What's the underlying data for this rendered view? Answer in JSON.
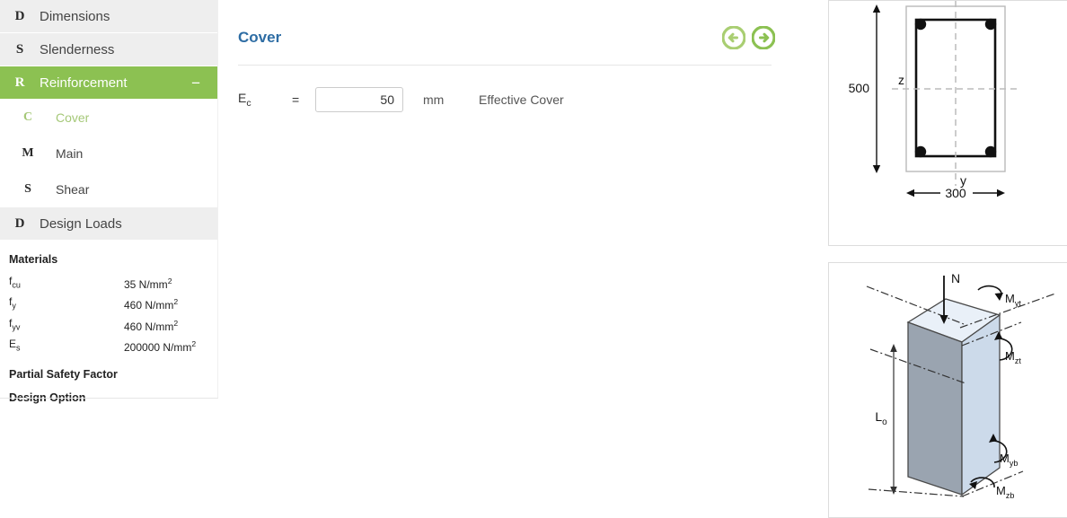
{
  "sidebar": {
    "nav_items": [
      {
        "icon": "D",
        "label": "Dimensions",
        "active": false,
        "toggle": ""
      },
      {
        "icon": "S",
        "label": "Slenderness",
        "active": false,
        "toggle": ""
      },
      {
        "icon": "R",
        "label": "Reinforcement",
        "active": true,
        "toggle": "−"
      }
    ],
    "sub_items": [
      {
        "icon": "C",
        "label": "Cover",
        "active": true
      },
      {
        "icon": "M",
        "label": "Main",
        "active": false
      },
      {
        "icon": "S",
        "label": "Shear",
        "active": false
      }
    ],
    "design_loads": {
      "icon": "D",
      "label": "Design Loads"
    },
    "materials": {
      "heading": "Materials",
      "rows": [
        {
          "symbol_main": "f",
          "symbol_sub": "cu",
          "value": "35 N/mm",
          "value_sup": "2"
        },
        {
          "symbol_main": "f",
          "symbol_sub": "y",
          "value": "460 N/mm",
          "value_sup": "2"
        },
        {
          "symbol_main": "f",
          "symbol_sub": "yv",
          "value": "460 N/mm",
          "value_sup": "2"
        },
        {
          "symbol_main": "E",
          "symbol_sub": "s",
          "value": "200000 N/mm",
          "value_sup": "2"
        }
      ],
      "partial_safety_factor": "Partial Safety Factor",
      "design_option": "Design Option"
    }
  },
  "main": {
    "title": "Cover",
    "prev_label": "Previous",
    "next_label": "Next",
    "field": {
      "symbol_main": "E",
      "symbol_sub": "c",
      "equals": "=",
      "value": "50",
      "placeholder": "",
      "unit": "mm",
      "description": "Effective Cover"
    }
  },
  "figures": {
    "cross_section": {
      "depth_label": "500",
      "width_label": "300",
      "axis_z": "z",
      "axis_y": "y"
    },
    "column_3d": {
      "axial_label": "N",
      "length_label_main": "L",
      "length_label_sub": "o",
      "moments": [
        {
          "main": "M",
          "sub": "yt"
        },
        {
          "main": "M",
          "sub": "zt"
        },
        {
          "main": "M",
          "sub": "yb"
        },
        {
          "main": "M",
          "sub": "zb"
        }
      ]
    }
  },
  "colors": {
    "accent_green": "#8cc152",
    "sub_active_green": "#a5c878",
    "title_blue": "#2e6da4",
    "row_gray": "#eeeeee"
  }
}
